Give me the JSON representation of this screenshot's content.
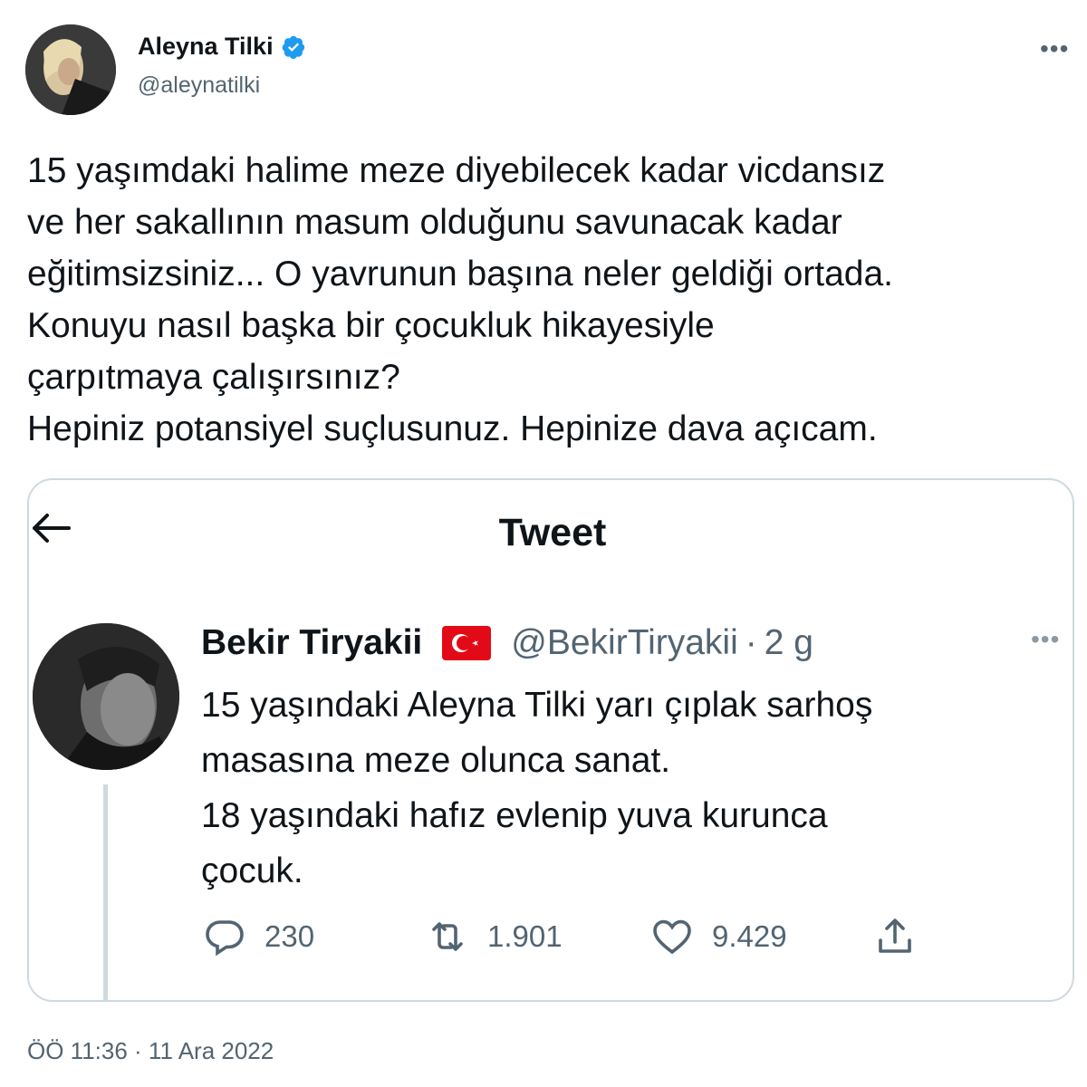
{
  "author": {
    "name": "Aleyna Tilki",
    "handle": "@aleynatilki",
    "verified": true,
    "verified_color": "#1d9bf0"
  },
  "tweet": {
    "text": "15 yaşımdaki halime meze diyebilecek kadar vicdansız\nve her sakallının masum olduğunu savunacak kadar\neğitimsizsiniz... O yavrunun başına neler geldiği ortada.\nKonuyu nasıl başka bir çocukluk hikayesiyle\nçarpıtmaya çalışırsınız?\nHepiniz potansiyel suçlusunuz. Hepinize dava açıcam.",
    "timestamp": "ÖÖ 11:36 · 11 Ara 2022"
  },
  "quoted": {
    "page_title": "Tweet",
    "name": "Bekir Tiryakii",
    "flag_icon": "turkey-flag-icon",
    "handle": "@BekirTiryakii",
    "separator": "·",
    "time": "2 g",
    "text": "15 yaşındaki Aleyna Tilki yarı çıplak sarhoş\nmasasına meze olunca sanat.\n18 yaşındaki hafız evlenip yuva kurunca\nçocuk.",
    "actions": {
      "replies": "230",
      "retweets": "1.901",
      "likes": "9.429"
    }
  },
  "icons": {
    "more": "more-horizontal-icon",
    "back": "back-arrow-icon",
    "reply": "reply-icon",
    "retweet": "retweet-icon",
    "like": "heart-icon",
    "share": "share-icon"
  },
  "colors": {
    "text_primary": "#0f1419",
    "text_secondary": "#536471",
    "border": "#cfd9de",
    "flag_red": "#e30a17"
  }
}
